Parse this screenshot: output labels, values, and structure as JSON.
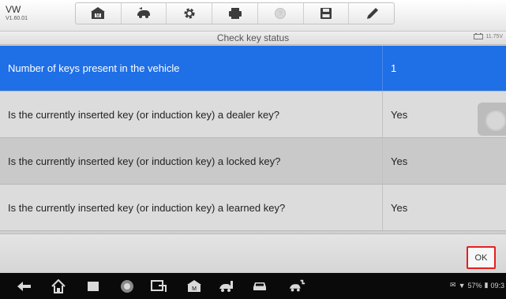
{
  "app": {
    "brand": "VW",
    "version": "V1.60.01",
    "title": "Check key status",
    "battery_voltage": "11.75V"
  },
  "toolbar": {
    "items": [
      "home-icon",
      "vehicle-swap-icon",
      "settings-icon",
      "print-icon",
      "help-icon",
      "save-icon",
      "pen-icon"
    ]
  },
  "table": {
    "rows": [
      {
        "question": "Number of keys present in the vehicle",
        "answer": "1",
        "selected": true
      },
      {
        "question": "Is the currently inserted key (or induction key) a dealer key?",
        "answer": "Yes",
        "selected": false
      },
      {
        "question": "Is the currently inserted key (or induction key) a locked key?",
        "answer": "Yes",
        "selected": false
      },
      {
        "question": "Is the currently inserted key (or induction key) a learned key?",
        "answer": "Yes",
        "selected": false
      }
    ]
  },
  "actions": {
    "ok_label": "OK"
  },
  "status_bar": {
    "battery": "57%",
    "time": "09:3"
  },
  "colors": {
    "selected_row": "#1f6fe6",
    "ok_border": "#e32020"
  }
}
